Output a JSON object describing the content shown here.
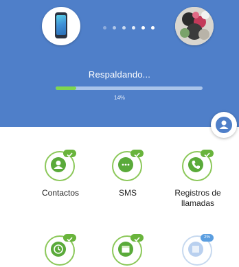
{
  "header": {
    "status": "Respaldando...",
    "progress_percent": 14,
    "progress_label": "14%",
    "page_dots": 6,
    "active_dot": 4,
    "colors": {
      "background": "#4f7fc9",
      "progress": "#7fd64f",
      "track": "#a9c4ea"
    }
  },
  "devices": {
    "source_icon": "phone-icon",
    "target_icon": "photo-avatar-icon"
  },
  "categories": [
    {
      "label": "Contactos",
      "icon": "contact-icon",
      "status": "done"
    },
    {
      "label": "SMS",
      "icon": "message-icon",
      "status": "done"
    },
    {
      "label": "Registros de llamadas",
      "icon": "phone-call-icon",
      "status": "done"
    },
    {
      "label": "",
      "icon": "clock-icon",
      "status": "done"
    },
    {
      "label": "",
      "icon": "calendar-icon",
      "status": "done"
    },
    {
      "label": "",
      "icon": "gallery-icon",
      "status": "in-progress",
      "badge": "2%"
    }
  ],
  "accent_green": "#69b43c"
}
